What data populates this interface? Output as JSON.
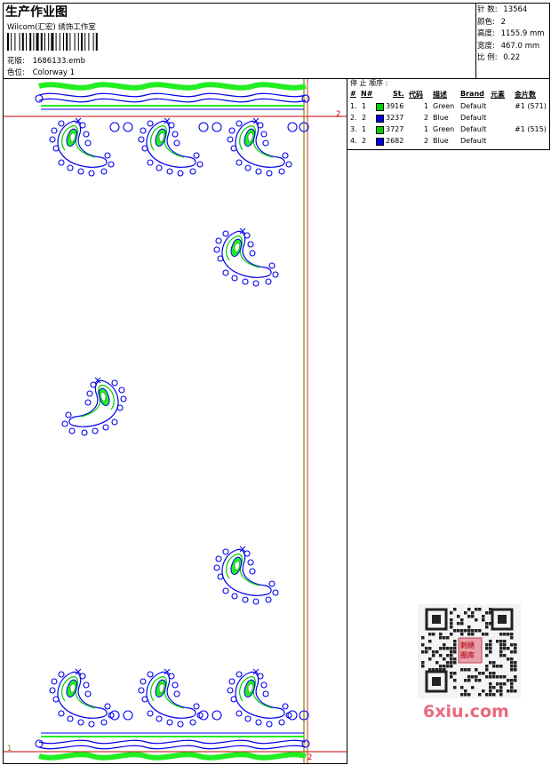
{
  "header": {
    "title": "生产作业图",
    "studio": "Wilcom(汇宏) 绣饰工作室",
    "design_label": "花版:",
    "design_value": "1686133.emb",
    "colorway_label": "色位:",
    "colorway_value": "Colorway 1"
  },
  "stats": {
    "stitches_label": "针 数:",
    "stitches_value": "13564",
    "colors_label": "颜色:",
    "colors_value": "2",
    "height_label": "高度:",
    "height_value": "1155.9 mm",
    "width_label": "宽度:",
    "width_value": "467.0 mm",
    "scale_label": "比 例:",
    "scale_value": "0.22"
  },
  "sequence": {
    "title": "停 止 顺序 :",
    "columns": [
      "#",
      "N#",
      "St.",
      "代码",
      "描述",
      "Brand",
      "元素",
      "金片数"
    ],
    "rows": [
      {
        "idx": "1.",
        "n": "1",
        "stitches": "3916",
        "code": "1",
        "desc": "Green",
        "brand": "Default",
        "element": "",
        "sequins": "#1 (571)",
        "color": "#00d000"
      },
      {
        "idx": "2.",
        "n": "2",
        "stitches": "3237",
        "code": "2",
        "desc": "Blue",
        "brand": "Default",
        "element": "",
        "sequins": "",
        "color": "#0000e0"
      },
      {
        "idx": "3.",
        "n": "1",
        "stitches": "3727",
        "code": "1",
        "desc": "Green",
        "brand": "Default",
        "element": "",
        "sequins": "#1 (515)",
        "color": "#00d000"
      },
      {
        "idx": "4.",
        "n": "2",
        "stitches": "2682",
        "code": "2",
        "desc": "Blue",
        "brand": "Default",
        "element": "",
        "sequins": "",
        "color": "#0000e0"
      }
    ]
  },
  "design_area": {
    "marker_top_right": "2",
    "marker_bottom_left": "1",
    "marker_bottom_right": "2"
  },
  "watermark": {
    "brand": "6xiu.com",
    "badge_text": "刺绣图库"
  },
  "colors": {
    "green": "#00ff00",
    "blue": "#0000ee",
    "guide_red": "#cc0000",
    "guide_olive": "#7a8a00"
  }
}
